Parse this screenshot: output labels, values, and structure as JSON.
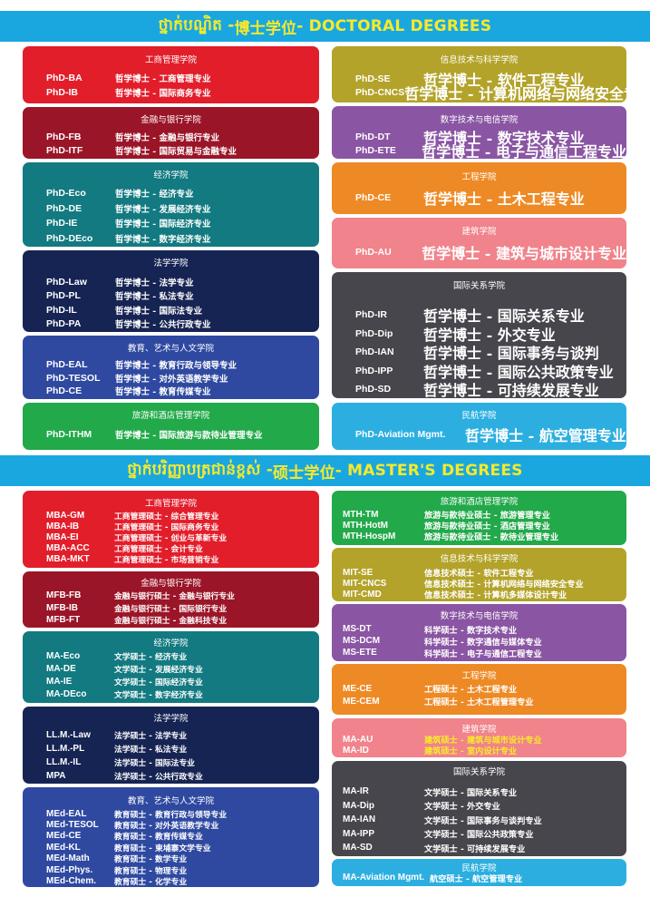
{
  "doctoral_banner": {
    "kh": "ថ្នាក់បណ្ឌិត - ",
    "zh": "博士学位",
    "en": " - DOCTORAL DEGREES"
  },
  "master_banner": {
    "kh": "ថ្នាក់បរិញ្ញាបត្រជាន់ខ្ពស់ - ",
    "zh": "硕士学位",
    "en": " - MASTER'S DEGREES"
  },
  "colors": {
    "banner": "#1aa7e0",
    "banner_text": "#f7ea2a",
    "red": "#e21e2b",
    "maroon": "#9b1528",
    "teal": "#127a80",
    "navy": "#162453",
    "blue": "#2f49a1",
    "green": "#22a94a",
    "olive": "#b3a32a",
    "purple": "#8a55a3",
    "orange": "#ee8a25",
    "pink": "#f0838b",
    "dark": "#47464c",
    "sky": "#2cafe0"
  },
  "doctoral": {
    "left": [
      {
        "title": "工商管理学院",
        "rows": [
          {
            "code": "PhD-BA",
            "desc": "哲学博士 - 工商管理专业"
          },
          {
            "code": "PhD-IB",
            "desc": "哲学博士 - 国际商务专业"
          }
        ]
      },
      {
        "title": "金融与银行学院",
        "rows": [
          {
            "code": "PhD-FB",
            "desc": "哲学博士 - 金融与银行专业"
          },
          {
            "code": "PhD-ITF",
            "desc": "哲学博士 - 国际贸易与金融专业"
          }
        ]
      },
      {
        "title": "经济学院",
        "rows": [
          {
            "code": "PhD-Eco",
            "desc": "哲学博士 - 经济专业"
          },
          {
            "code": "PhD-DE",
            "desc": "哲学博士 - 发展经济专业"
          },
          {
            "code": "PhD-IE",
            "desc": "哲学博士 - 国际经济专业"
          },
          {
            "code": "PhD-DEco",
            "desc": "哲学博士 - 数字经济专业"
          }
        ]
      },
      {
        "title": "法学学院",
        "rows": [
          {
            "code": "PhD-Law",
            "desc": "哲学博士 - 法学专业"
          },
          {
            "code": "PhD-PL",
            "desc": "哲学博士 - 私法专业"
          },
          {
            "code": "PhD-IL",
            "desc": "哲学博士 - 国际法专业"
          },
          {
            "code": "PhD-PA",
            "desc": "哲学博士 - 公共行政专业"
          }
        ]
      },
      {
        "title": "教育、艺术与人文学院",
        "rows": [
          {
            "code": "PhD-EAL",
            "desc": "哲学博士 - 教育行政与领导专业"
          },
          {
            "code": "PhD-TESOL",
            "desc": "哲学博士 - 对外英语教学专业"
          },
          {
            "code": "PhD-CE",
            "desc": "哲学博士 - 教育传媒专业"
          }
        ]
      },
      {
        "title": "旅游和酒店管理学院",
        "rows": [
          {
            "code": "PhD-ITHM",
            "desc": "哲学博士 - 国际旅游与款待业管理专业"
          }
        ]
      }
    ],
    "right": [
      {
        "title": "信息技术与科学学院",
        "rows": [
          {
            "code": "PhD-SE",
            "desc": "哲学博士 - 软件工程专业"
          },
          {
            "code": "PhD-CNCS",
            "desc": "哲学博士 - 计算机网络与网络安全专业"
          }
        ]
      },
      {
        "title": "数字技术与电信学院",
        "rows": [
          {
            "code": "PhD-DT",
            "desc": "哲学博士 - 数字技术专业"
          },
          {
            "code": "PhD-ETE",
            "desc": "哲学博士 - 电子与通信工程专业"
          }
        ]
      },
      {
        "title": "工程学院",
        "rows": [
          {
            "code": "PhD-CE",
            "desc": "哲学博士 - 土木工程专业"
          }
        ]
      },
      {
        "title": "建筑学院",
        "rows": [
          {
            "code": "PhD-AU",
            "desc": "哲学博士 - 建筑与城市设计专业"
          }
        ]
      },
      {
        "title": "国际关系学院",
        "rows": [
          {
            "code": "PhD-IR",
            "desc": "哲学博士 - 国际关系专业"
          },
          {
            "code": "PhD-Dip",
            "desc": "哲学博士 - 外交专业"
          },
          {
            "code": "PhD-IAN",
            "desc": "哲学博士 - 国际事务与谈判"
          },
          {
            "code": "PhD-IPP",
            "desc": "哲学博士 - 国际公共政策专业"
          },
          {
            "code": "PhD-SD",
            "desc": "哲学博士 - 可持续发展专业"
          }
        ]
      },
      {
        "title": "民航学院",
        "rows": [
          {
            "code": "PhD-Aviation Mgmt.",
            "desc": "哲学博士 - 航空管理专业"
          }
        ]
      }
    ]
  },
  "master": {
    "left": [
      {
        "title": "工商管理学院",
        "rows": [
          {
            "code": "MBA-GM",
            "desc": "工商管理硕士 - 综合管理专业"
          },
          {
            "code": "MBA-IB",
            "desc": "工商管理硕士 - 国际商务专业"
          },
          {
            "code": "MBA-EI",
            "desc": "工商管理硕士 - 创业与革新专业"
          },
          {
            "code": "MBA-ACC",
            "desc": "工商管理硕士 - 会计专业"
          },
          {
            "code": "MBA-MKT",
            "desc": "工商管理硕士 - 市场营销专业"
          }
        ]
      },
      {
        "title": "金融与银行学院",
        "rows": [
          {
            "code": "MFB-FB",
            "desc": "金融与银行硕士 - 金融与银行专业"
          },
          {
            "code": "MFB-IB",
            "desc": "金融与银行硕士 - 国际银行专业"
          },
          {
            "code": "MFB-FT",
            "desc": "金融与银行硕士 - 金融科技专业"
          }
        ]
      },
      {
        "title": "经济学院",
        "rows": [
          {
            "code": "MA-Eco",
            "desc": "文学硕士 - 经济专业"
          },
          {
            "code": "MA-DE",
            "desc": "文学硕士 - 发展经济专业"
          },
          {
            "code": "MA-IE",
            "desc": "文学硕士 - 国际经济专业"
          },
          {
            "code": "MA-DEco",
            "desc": "文学硕士 - 数字经济专业"
          }
        ]
      },
      {
        "title": "法学学院",
        "rows": [
          {
            "code": "LL.M.-Law",
            "desc": "法学硕士 - 法学专业"
          },
          {
            "code": "LL.M.-PL",
            "desc": "法学硕士 - 私法专业"
          },
          {
            "code": "LL.M.-IL",
            "desc": "法学硕士 - 国际法专业"
          },
          {
            "code": "MPA",
            "desc": "法学硕士 - 公共行政专业"
          }
        ]
      },
      {
        "title": "教育、艺术与人文学院",
        "rows": [
          {
            "code": "MEd-EAL",
            "desc": "教育硕士 - 教育行政与领导专业"
          },
          {
            "code": "MEd-TESOL",
            "desc": "教育硕士 - 对外英语教学专业"
          },
          {
            "code": "MEd-CE",
            "desc": "教育硕士 - 教育传媒专业"
          },
          {
            "code": "MEd-KL",
            "desc": "教育硕士 - 柬埔寨文学专业"
          },
          {
            "code": "MEd-Math",
            "desc": "教育硕士 - 数学专业"
          },
          {
            "code": "MEd-Phys.",
            "desc": "教育硕士 - 物理专业"
          },
          {
            "code": "MEd-Chem.",
            "desc": "教育硕士 - 化学专业"
          }
        ]
      }
    ],
    "right": [
      {
        "title": "旅游和酒店管理学院",
        "rows": [
          {
            "code": "MTH-TM",
            "desc": "旅游与款待业硕士 - 旅游管理专业"
          },
          {
            "code": "MTH-HotM",
            "desc": "旅游与款待业硕士 - 酒店管理专业"
          },
          {
            "code": "MTH-HospM",
            "desc": "旅游与款待业硕士 - 款待业管理专业"
          }
        ]
      },
      {
        "title": "信息技术与科学学院",
        "rows": [
          {
            "code": "MIT-SE",
            "desc": "信息技术硕士 - 软件工程专业"
          },
          {
            "code": "MIT-CNCS",
            "desc": "信息技术硕士 - 计算机网络与网络安全专业"
          },
          {
            "code": "MIT-CMD",
            "desc": "信息技术硕士 - 计算机多媒体设计专业"
          }
        ]
      },
      {
        "title": "数字技术与电信学院",
        "rows": [
          {
            "code": "MS-DT",
            "desc": "科学硕士 - 数字技术专业"
          },
          {
            "code": "MS-DCM",
            "desc": "科学硕士 - 数字通信与媒体专业"
          },
          {
            "code": "MS-ETE",
            "desc": "科学硕士 - 电子与通信工程专业"
          }
        ]
      },
      {
        "title": "工程学院",
        "rows": [
          {
            "code": "ME-CE",
            "desc": "工程硕士 - 土木工程专业"
          },
          {
            "code": "ME-CEM",
            "desc": "工程硕士 - 土木工程管理专业"
          }
        ]
      },
      {
        "title": "建筑学院",
        "rows": [
          {
            "code": "MA-AU",
            "desc": "建筑硕士 - 建筑与城市设计专业"
          },
          {
            "code": "MA-ID",
            "desc": "建筑硕士 - 室内设计专业"
          }
        ]
      },
      {
        "title": "国际关系学院",
        "rows": [
          {
            "code": "MA-IR",
            "desc": "文学硕士 - 国际关系专业"
          },
          {
            "code": "MA-Dip",
            "desc": "文学硕士 - 外交专业"
          },
          {
            "code": "MA-IAN",
            "desc": "文学硕士 - 国际事务与谈判专业"
          },
          {
            "code": "MA-IPP",
            "desc": "文学硕士 - 国际公共政策专业"
          },
          {
            "code": "MA-SD",
            "desc": "文学硕士 - 可持续发展专业"
          }
        ]
      },
      {
        "title": "民航学院",
        "rows": [
          {
            "code": "MA-Aviation Mgmt.",
            "desc": "航空硕士 - 航空管理专业"
          }
        ]
      }
    ]
  }
}
